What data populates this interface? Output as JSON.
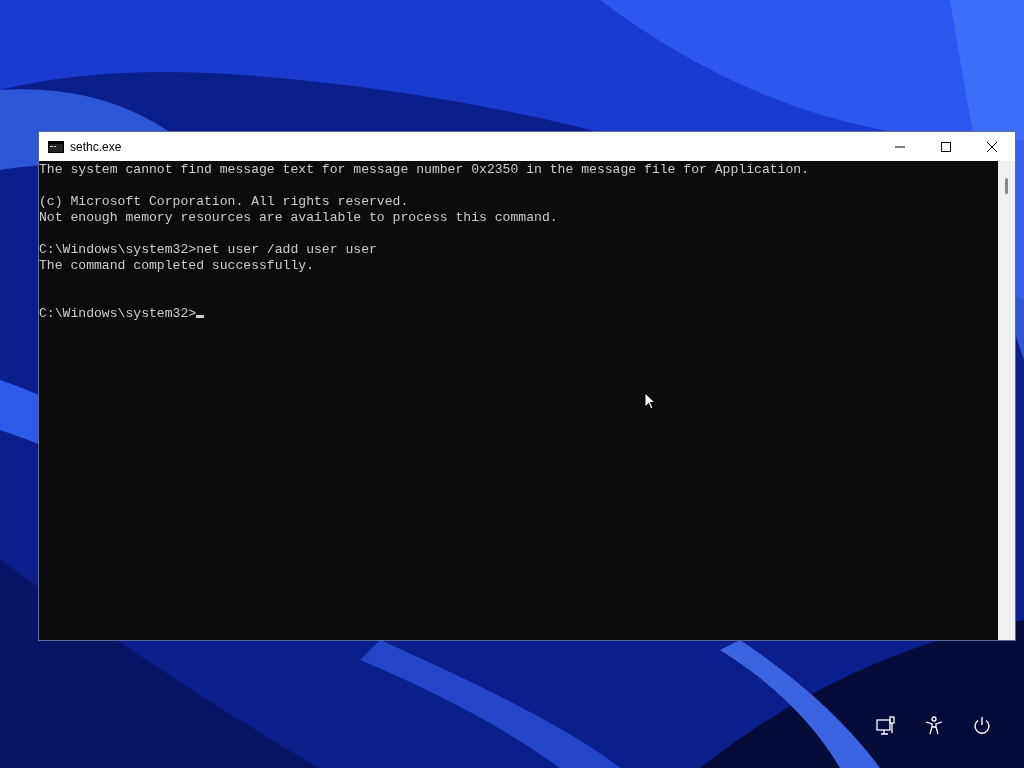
{
  "window": {
    "title": "sethc.exe"
  },
  "console": {
    "blocks": [
      {
        "wide_gap": false,
        "lines": [
          {
            "text": "The system cannot find message text for message number 0x2350 in the message file for Application.",
            "cursor": false
          }
        ]
      },
      {
        "wide_gap": false,
        "lines": [
          {
            "text": "(c) Microsoft Corporation. All rights reserved.",
            "cursor": false
          },
          {
            "text": "Not enough memory resources are available to process this command.",
            "cursor": false
          }
        ]
      },
      {
        "wide_gap": false,
        "lines": [
          {
            "text": "C:\\Windows\\system32>net user /add user user",
            "cursor": false
          },
          {
            "text": "The command completed successfully.",
            "cursor": false
          }
        ]
      },
      {
        "wide_gap": true,
        "lines": [
          {
            "text": "C:\\Windows\\system32>",
            "cursor": true
          }
        ]
      }
    ]
  },
  "lock_screen": {
    "buttons": [
      {
        "kind": "network"
      },
      {
        "kind": "accessibility"
      },
      {
        "kind": "power"
      }
    ]
  }
}
